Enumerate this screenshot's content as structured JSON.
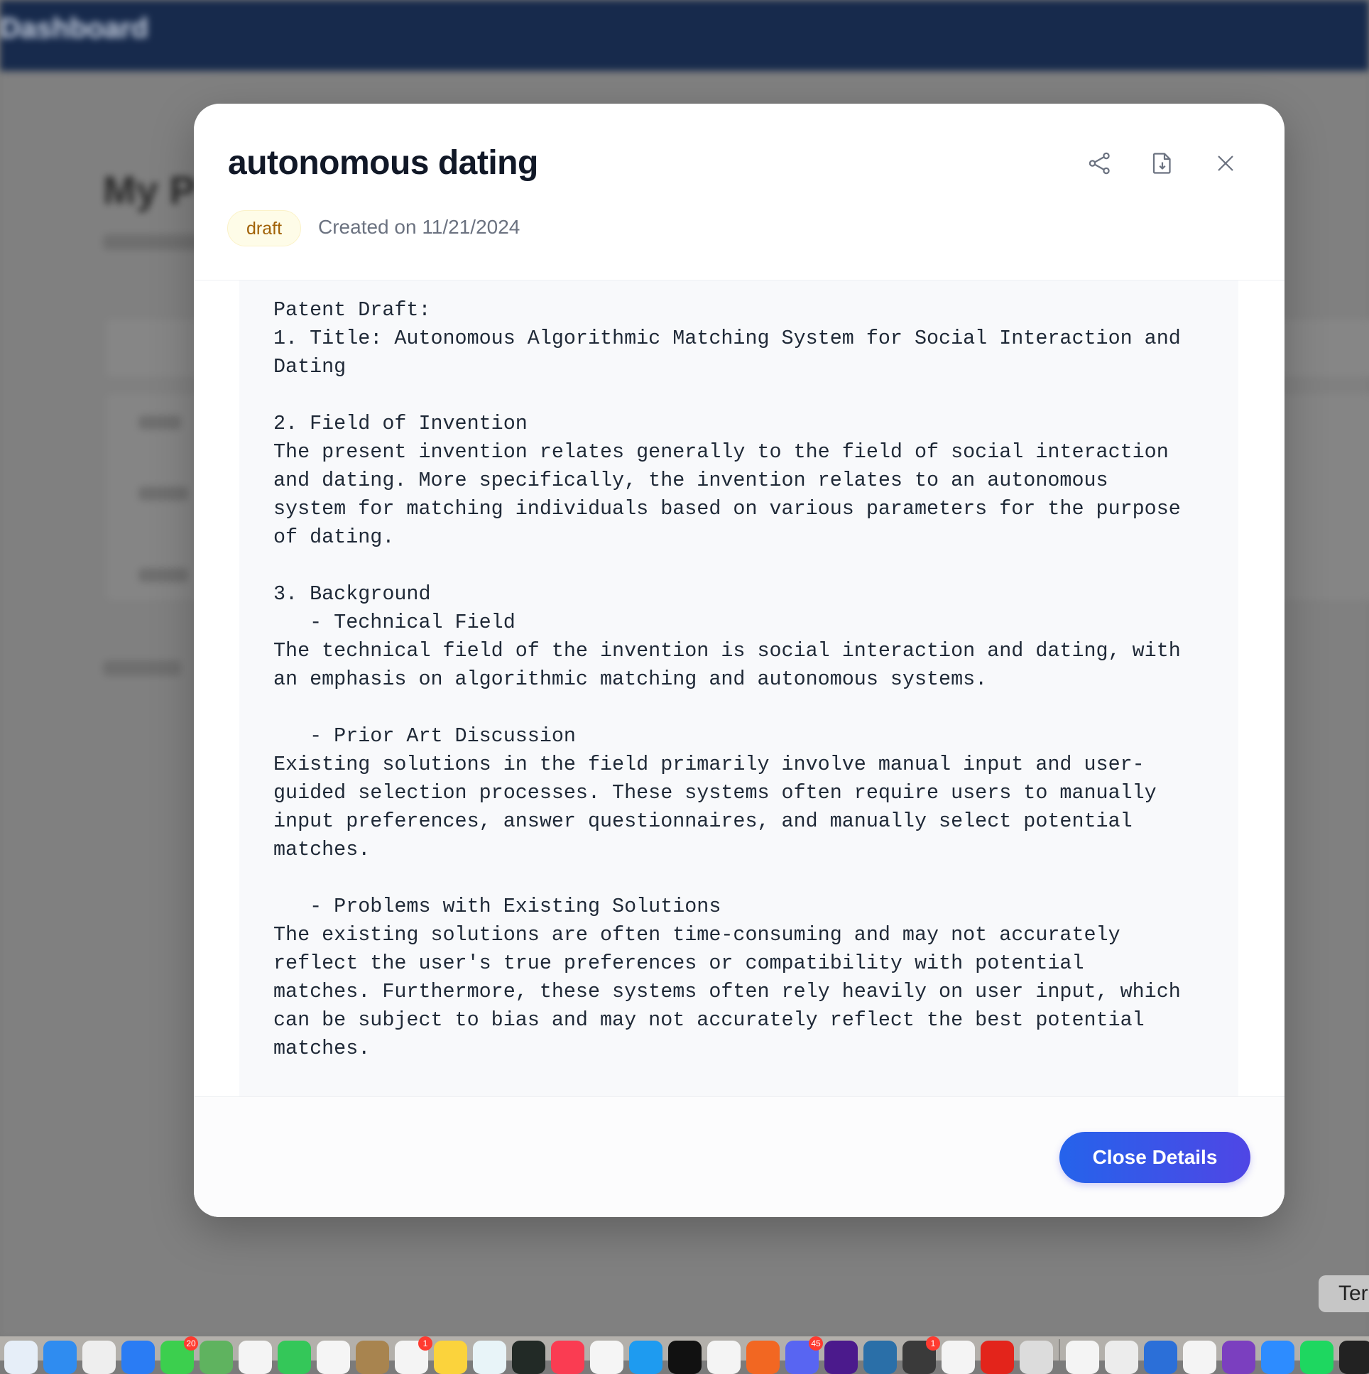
{
  "background": {
    "topbar_brand": "Dashboard",
    "heading_partial": "My P"
  },
  "modal": {
    "title": "autonomous dating",
    "status_badge": "draft",
    "created": "Created on 11/21/2024",
    "icons": {
      "share": "share-icon",
      "download": "file-download-icon",
      "close": "close-icon"
    },
    "content": "Patent Draft:\n1. Title: Autonomous Algorithmic Matching System for Social Interaction and\nDating\n\n2. Field of Invention\nThe present invention relates generally to the field of social interaction\nand dating. More specifically, the invention relates to an autonomous\nsystem for matching individuals based on various parameters for the purpose\nof dating.\n\n3. Background\n   - Technical Field\nThe technical field of the invention is social interaction and dating, with\nan emphasis on algorithmic matching and autonomous systems.\n\n   - Prior Art Discussion\nExisting solutions in the field primarily involve manual input and user-\nguided selection processes. These systems often require users to manually\ninput preferences, answer questionnaires, and manually select potential\nmatches.\n\n   - Problems with Existing Solutions\nThe existing solutions are often time-consuming and may not accurately\nreflect the user's true preferences or compatibility with potential\nmatches. Furthermore, these systems often rely heavily on user input, which\ncan be subject to bias and may not accurately reflect the best potential\nmatches.",
    "close_button": "Close Details"
  },
  "colors": {
    "accent_start": "#2563eb",
    "accent_end": "#4f46e5",
    "badge_text": "#a16207",
    "topbar": "#172a4c"
  },
  "tooltip": "Ter",
  "dock": {
    "icons": [
      {
        "color": "#e6eef8"
      },
      {
        "color": "#2f8cf0"
      },
      {
        "color": "#eeeeee"
      },
      {
        "color": "#2a7cf4"
      },
      {
        "color": "#3ccf4e",
        "badge": "20"
      },
      {
        "color": "#5fb35f"
      },
      {
        "color": "#f4f4f4"
      },
      {
        "color": "#34c759"
      },
      {
        "color": "#f5f5f5"
      },
      {
        "color": "#a8844f"
      },
      {
        "color": "#f4f4f4",
        "badge": "1"
      },
      {
        "color": "#fbd33c"
      },
      {
        "color": "#e8f4f8"
      },
      {
        "color": "#222a26"
      },
      {
        "color": "#fa3c52"
      },
      {
        "color": "#f5f5f5"
      },
      {
        "color": "#1e9bf0"
      },
      {
        "color": "#111111"
      },
      {
        "color": "#f4f4f4"
      },
      {
        "color": "#f26722"
      },
      {
        "color": "#5865f2",
        "badge": "45"
      },
      {
        "color": "#4b1a8c"
      },
      {
        "color": "#2a6fa8"
      },
      {
        "color": "#3a3a3a",
        "badge": "1"
      },
      {
        "color": "#f4f4f4"
      },
      {
        "color": "#e3241b"
      },
      {
        "color": "#dcdcdc"
      }
    ],
    "icons_right": [
      {
        "color": "#f4f4f4"
      },
      {
        "color": "#ececec"
      },
      {
        "color": "#2b6fd8"
      },
      {
        "color": "#f4f4f4"
      },
      {
        "color": "#7b3fbf"
      },
      {
        "color": "#2d8cff"
      },
      {
        "color": "#1ed760"
      },
      {
        "color": "#222222"
      }
    ]
  }
}
